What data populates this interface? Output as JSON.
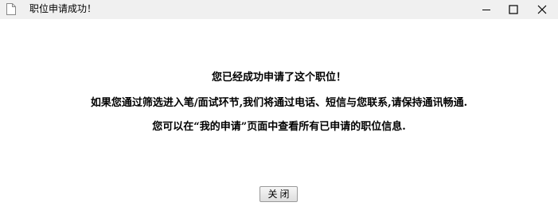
{
  "window": {
    "title": "职位申请成功！",
    "page_icon": "document-icon",
    "controls": {
      "minimize_icon": "minimize-icon",
      "maximize_icon": "maximize-icon",
      "close_icon": "close-icon"
    }
  },
  "message": {
    "line1": "您已经成功申请了这个职位！",
    "line2": "如果您通过筛选进入笔/面试环节,我们将通过电话、短信与您联系,请保持通讯畅通.",
    "line3": "您可以在“我的申请”页面中查看所有已申请的职位信息."
  },
  "actions": {
    "close_label": "关闭"
  }
}
